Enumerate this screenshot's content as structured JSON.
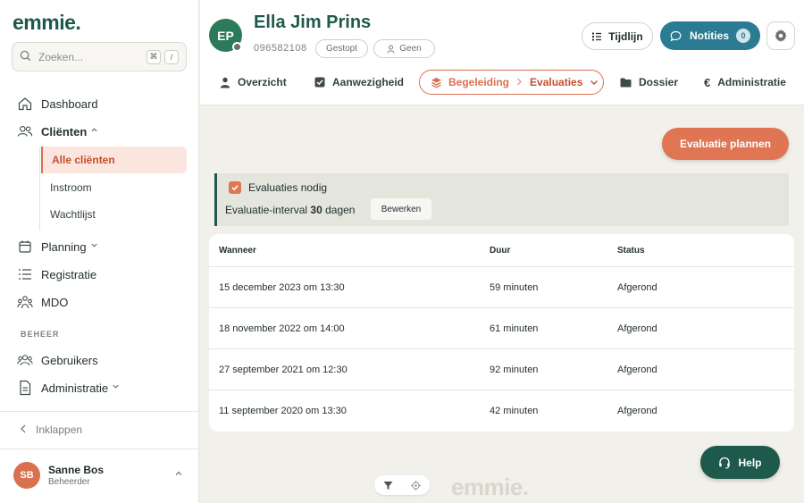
{
  "sidebar": {
    "logo": "emmie.",
    "search": {
      "placeholder": "Zoeken...",
      "shortcut_1": "⌘",
      "shortcut_2": "/"
    },
    "nav": {
      "dashboard": "Dashboard",
      "clienten": "Cliënten",
      "planning": "Planning",
      "registratie": "Registratie",
      "mdo": "MDO",
      "gebruikers": "Gebruikers",
      "administratie": "Administratie"
    },
    "subnav": [
      "Alle cliënten",
      "Instroom",
      "Wachtlijst"
    ],
    "section_beheer": "BEHEER",
    "collapse": "Inklappen",
    "user": {
      "initials": "SB",
      "name": "Sanne Bos",
      "role": "Beheerder"
    }
  },
  "header": {
    "initials": "EP",
    "client_name": "Ella Jim Prins",
    "client_id": "096582108",
    "status_pill": "Gestopt",
    "person_pill": "Geen",
    "tijdlijn": "Tijdlijn",
    "notities": "Notities",
    "notities_count": "0"
  },
  "tabs": {
    "overzicht": "Overzicht",
    "aanwezigheid": "Aanwezigheid",
    "begeleiding": "Begeleiding",
    "evaluaties": "Evaluaties",
    "dossier": "Dossier",
    "administratie": "Administratie"
  },
  "main": {
    "plan_button": "Evaluatie plannen",
    "eval_needed": "Evaluaties nodig",
    "interval_prefix": "Evaluatie-interval",
    "interval_value": "30",
    "interval_unit": "dagen",
    "edit_button": "Bewerken",
    "table": {
      "headers": [
        "Wanneer",
        "Duur",
        "Status"
      ],
      "rows": [
        [
          "15 december 2023 om 13:30",
          "59 minuten",
          "Afgerond"
        ],
        [
          "18 november 2022 om 14:00",
          "61 minuten",
          "Afgerond"
        ],
        [
          "27 september 2021 om 12:30",
          "92 minuten",
          "Afgerond"
        ],
        [
          "11 september 2020 om 13:30",
          "42 minuten",
          "Afgerond"
        ]
      ]
    },
    "help": "Help",
    "footer_logo": "emmie."
  },
  "colors": {
    "brand_green": "#1e5a4b",
    "accent_orange": "#e07554",
    "teal": "#2b7c92"
  }
}
